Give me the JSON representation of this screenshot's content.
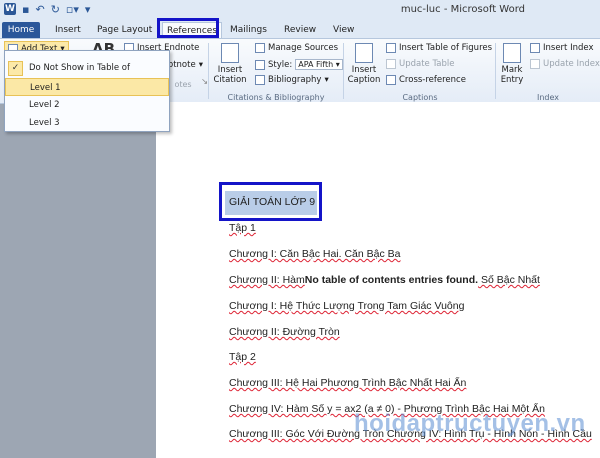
{
  "window": {
    "title": "muc-luc - Microsoft Word",
    "app_letter": "W"
  },
  "tabs": [
    "Home",
    "Insert",
    "Page Layout",
    "References",
    "Mailings",
    "Review",
    "View"
  ],
  "ribbon": {
    "add_text": "Add Text",
    "insert_endnote": "Insert Endnote",
    "footnote_frag": "otnote",
    "ab_glyph": "AB",
    "footnotes_frag": "otes",
    "insert_citation": "Insert\nCitation",
    "manage_sources": "Manage Sources",
    "style_label": "Style:",
    "style_value": "APA Fifth",
    "bibliography": "Bibliography",
    "citations_group": "Citations & Bibliography",
    "insert_caption": "Insert\nCaption",
    "insert_table_of_figures": "Insert Table of Figures",
    "update_table": "Update Table",
    "cross_reference": "Cross-reference",
    "captions_group": "Captions",
    "mark_entry": "Mark\nEntry",
    "insert_index": "Insert Index",
    "update_index": "Update Index",
    "index_group": "Index"
  },
  "menu": {
    "items": [
      "Do Not Show in Table of Contents",
      "Level 1",
      "Level 2",
      "Level 3"
    ]
  },
  "document": {
    "heading": "GIẢI TOÁN LỚP 9",
    "lines": [
      [
        "Tập 1"
      ],
      [
        "Chương I: Căn Bậc Hai. Căn Bậc Ba"
      ],
      [
        "Chương II: Hàm",
        "No table of contents entries found.",
        " Số Bậc Nhất"
      ],
      [
        "Chương I: Hệ Thức Lượng Trong Tam Giác Vuông"
      ],
      [
        "Chương II: Đường Tròn"
      ],
      [
        "Tập 2"
      ],
      [
        "Chương III: Hệ Hai Phương Trình Bậc Nhất Hai Ẩn"
      ],
      [
        "Chương IV: Hàm Số y = ax2 (a ≠ 0) - Phương Trình Bậc Hai Một Ẩn"
      ],
      [
        "Chương III: Góc Với Đường Tròn Chương IV: Hình Trụ - Hình Nón - Hình Cầu"
      ]
    ]
  },
  "watermark": "hoidaptructuyen.vn"
}
